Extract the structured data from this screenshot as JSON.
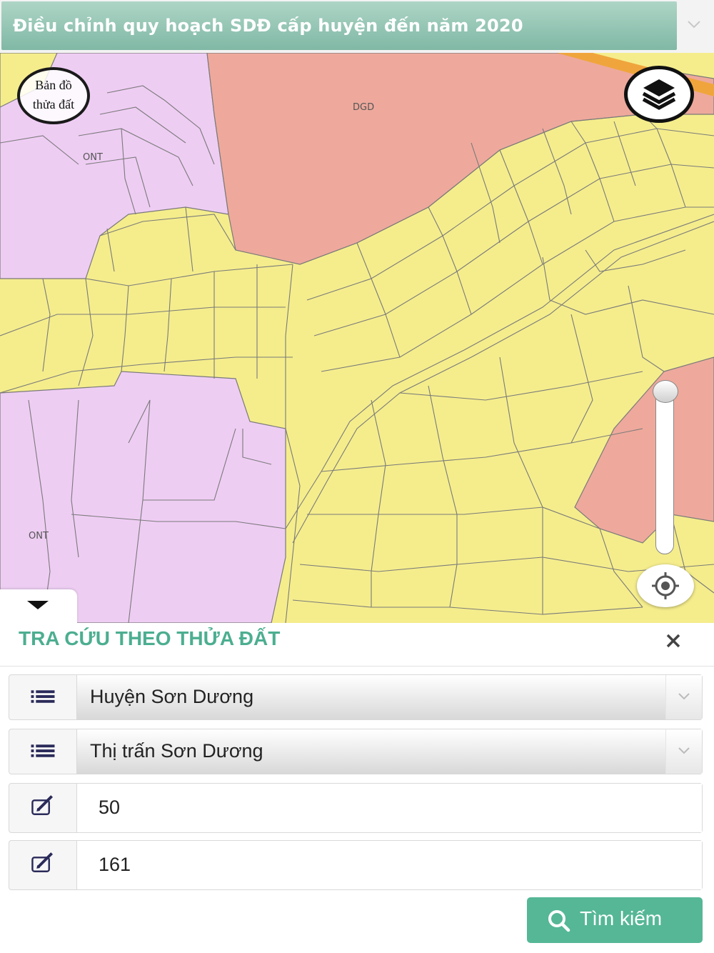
{
  "header": {
    "plan_title": "Điều chỉnh quy hoạch SDĐ cấp huyện đến năm 2020",
    "dropdown_icon": "chevron-down-icon"
  },
  "map": {
    "parcel_map_button": [
      "Bản đồ",
      "thửa đất"
    ],
    "labels": [
      "DGD",
      "ONT",
      "ONT"
    ],
    "layers_icon": "layers-icon",
    "locate_icon": "crosshair-icon",
    "collapse_icon": "caret-down-icon",
    "colors": {
      "agricultural_yellow": "#f5ed8c",
      "residential_pink": "#eecdf3",
      "education_salmon": "#eea99c",
      "road_orange": "#f0a53c",
      "accent_green": "#55b796"
    }
  },
  "panel": {
    "title": "TRA CỨU THEO THỬA ĐẤT",
    "close_icon": "close-icon",
    "district_select": "Huyện Sơn Dương",
    "commune_select": "Thị trấn Sơn Dương",
    "map_sheet_input": "50",
    "parcel_number_input": "161",
    "search_button": "Tìm kiếm",
    "list_icon": "list-icon",
    "edit_icon": "edit-icon",
    "search_icon": "search-icon"
  }
}
